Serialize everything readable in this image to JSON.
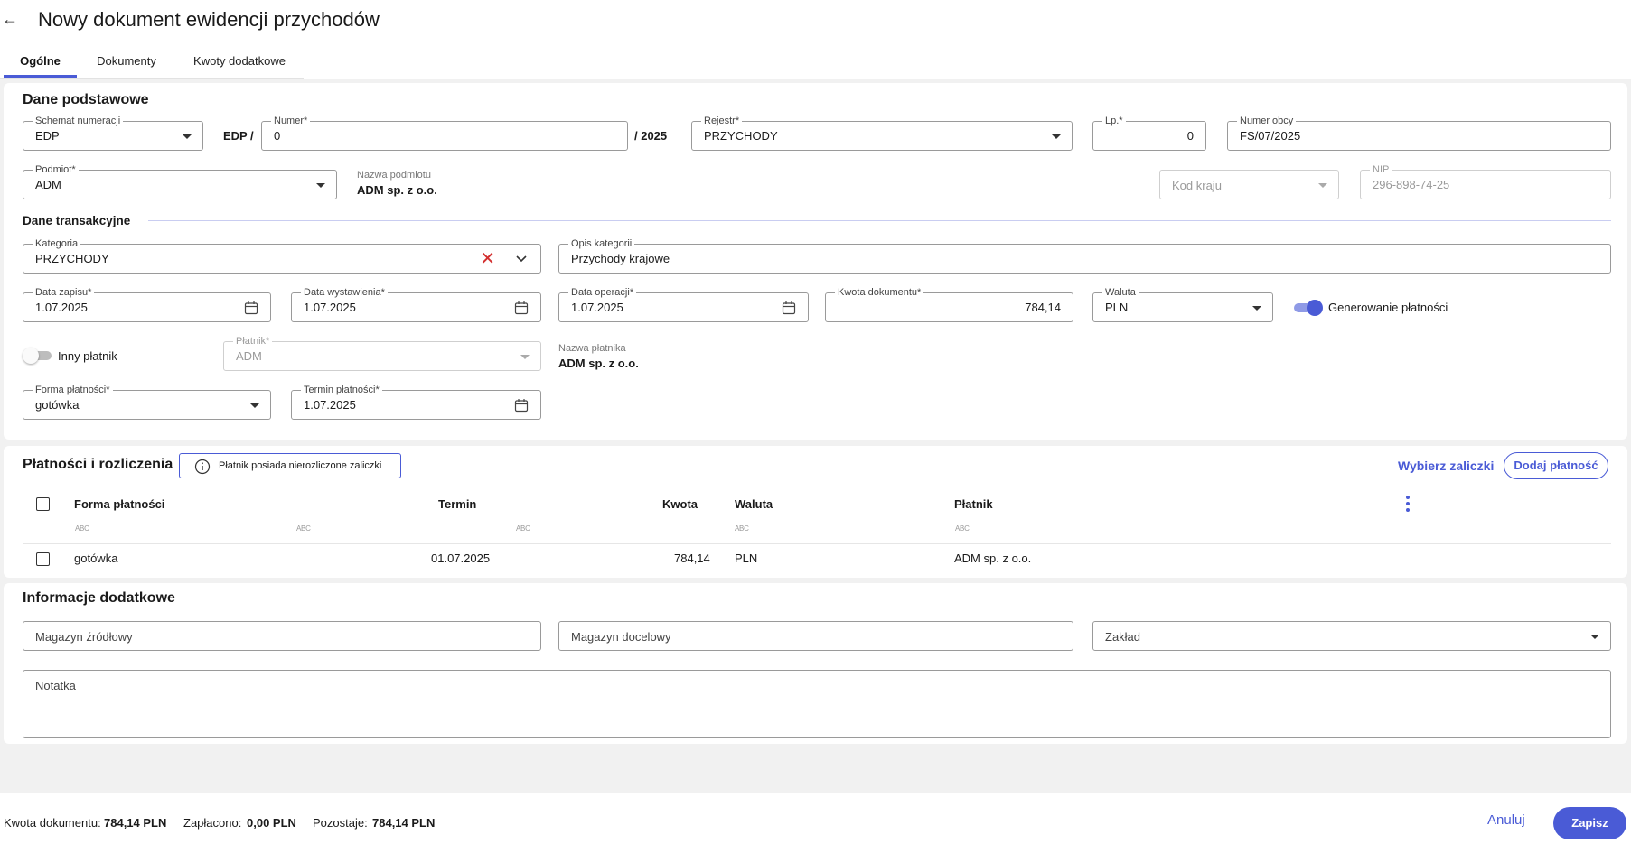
{
  "header": {
    "title": "Nowy dokument ewidencji przychodów",
    "tabs": [
      {
        "label": "Ogólne",
        "active": true
      },
      {
        "label": "Dokumenty",
        "active": false
      },
      {
        "label": "Kwoty dodatkowe",
        "active": false
      }
    ]
  },
  "basic": {
    "title": "Dane podstawowe",
    "numbering_scheme": {
      "label": "Schemat numeracji",
      "value": "EDP"
    },
    "prefix": "EDP",
    "slash": "/",
    "number": {
      "label": "Numer*",
      "value": "0"
    },
    "year": "/ 2025",
    "register": {
      "label": "Rejestr*",
      "value": "PRZYCHODY"
    },
    "lp": {
      "label": "Lp.*",
      "value": "0"
    },
    "foreign_number": {
      "label": "Numer obcy",
      "value": "FS/07/2025"
    },
    "subject": {
      "label": "Podmiot*",
      "value": "ADM"
    },
    "subject_name": {
      "label": "Nazwa podmiotu",
      "value": "ADM sp. z o.o."
    },
    "country_code": {
      "placeholder": "Kod kraju"
    },
    "nip": {
      "label": "NIP",
      "value": "296-898-74-25"
    }
  },
  "transaction": {
    "title": "Dane transakcyjne",
    "category": {
      "label": "Kategoria",
      "value": "PRZYCHODY"
    },
    "category_desc": {
      "label": "Opis kategorii",
      "value": "Przychody krajowe"
    },
    "entry_date": {
      "label": "Data zapisu*",
      "value": "1.07.2025"
    },
    "issue_date": {
      "label": "Data wystawienia*",
      "value": "1.07.2025"
    },
    "operation_date": {
      "label": "Data operacji*",
      "value": "1.07.2025"
    },
    "amount": {
      "label": "Kwota dokumentu*",
      "value": "784,14"
    },
    "currency": {
      "label": "Waluta",
      "value": "PLN"
    },
    "generate_payments": {
      "label": "Generowanie płatności",
      "on": true
    },
    "other_payer": {
      "label": "Inny płatnik",
      "on": false
    },
    "payer": {
      "label": "Płatnik*",
      "value": "ADM"
    },
    "payer_name": {
      "label": "Nazwa płatnika",
      "value": "ADM sp. z o.o."
    },
    "payment_form": {
      "label": "Forma płatności*",
      "value": "gotówka"
    },
    "payment_term": {
      "label": "Termin płatności*",
      "value": "1.07.2025"
    }
  },
  "payments": {
    "title": "Płatności i rozliczenia",
    "info": "Płatnik posiada nierozliczone zaliczki",
    "choose_advances": "Wybierz zaliczki",
    "add_payment": "Dodaj płatność",
    "columns": [
      "Forma płatności",
      "Termin",
      "Kwota",
      "Waluta",
      "Płatnik"
    ],
    "filter_icon_text": "ABC",
    "rows": [
      {
        "form": "gotówka",
        "term": "01.07.2025",
        "amount": "784,14",
        "currency": "PLN",
        "payer": "ADM sp. z o.o."
      }
    ]
  },
  "additional": {
    "title": "Informacje dodatkowe",
    "source_warehouse": "Magazyn źródłowy",
    "target_warehouse": "Magazyn docelowy",
    "plant": "Zakład",
    "note": "Notatka"
  },
  "footer": {
    "amount_label": "Kwota dokumentu:",
    "amount_value": "784,14 PLN",
    "paid_label": "Zapłacono:",
    "paid_value": "0,00 PLN",
    "remaining_label": "Pozostaje:",
    "remaining_value": "784,14 PLN",
    "cancel": "Anuluj",
    "save": "Zapisz"
  },
  "colors": {
    "accent": "#4a5bd6",
    "clear": "#d32f2f"
  }
}
